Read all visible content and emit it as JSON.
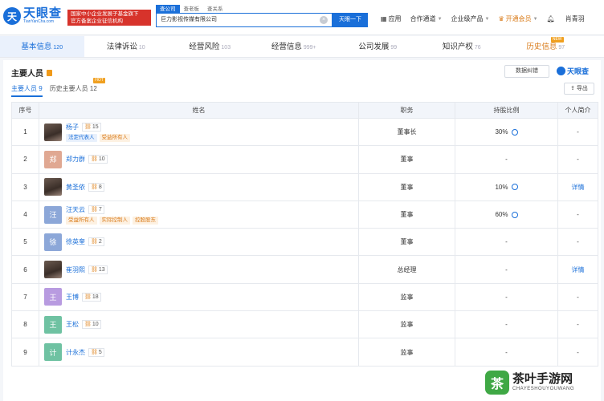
{
  "logo": {
    "cn": "天眼查",
    "en": "TianYanCha.com"
  },
  "gov_badge": {
    "line1": "国家中小企业发展子基金旗下",
    "line2": "官方备案企业征信机构"
  },
  "search": {
    "tabs": [
      "查公司",
      "查老板",
      "查关系"
    ],
    "value": "巨力影视传媒有限公司",
    "button": "天眼一下"
  },
  "topnav": [
    "应用",
    "合作通道",
    "企业级产品",
    "开通会员",
    "肖青羽"
  ],
  "main_tabs": [
    {
      "label": "基本信息",
      "count": "120"
    },
    {
      "label": "法律诉讼",
      "count": "10"
    },
    {
      "label": "经营风险",
      "count": "103"
    },
    {
      "label": "经营信息",
      "count": "999+"
    },
    {
      "label": "公司发展",
      "count": "99"
    },
    {
      "label": "知识产权",
      "count": "76"
    },
    {
      "label": "历史信息",
      "count": "97",
      "badge": "NEW"
    }
  ],
  "section": {
    "title": "主要人员",
    "correct_btn": "数据纠错",
    "brand": "天眼查",
    "export_btn": "导出",
    "sub_tabs": [
      {
        "label": "主要人员",
        "count": "9"
      },
      {
        "label": "历史主要人员",
        "count": "12",
        "badge": "HOT"
      }
    ]
  },
  "table": {
    "headers": [
      "序号",
      "姓名",
      "职务",
      "持股比例",
      "个人简介"
    ],
    "rows": [
      {
        "no": "1",
        "name": "杨子",
        "avatar": "photo",
        "count": "15",
        "tags": [
          {
            "t": "法定代表人",
            "c": "blue"
          },
          {
            "t": "受益所有人",
            "c": "orange"
          }
        ],
        "role": "董事长",
        "share": "30%",
        "clock": true,
        "bio": "-"
      },
      {
        "no": "2",
        "name": "郑力群",
        "avatar": "郑",
        "color": "#e0a892",
        "count": "10",
        "tags": [],
        "role": "董事",
        "share": "-",
        "clock": false,
        "bio": "-"
      },
      {
        "no": "3",
        "name": "黄圣依",
        "avatar": "photo",
        "count": "8",
        "tags": [],
        "role": "董事",
        "share": "10%",
        "clock": true,
        "bio": "详情"
      },
      {
        "no": "4",
        "name": "汪天云",
        "avatar": "汪",
        "color": "#8ca7d8",
        "count": "7",
        "tags": [
          {
            "t": "受益所有人",
            "c": "orange"
          },
          {
            "t": "实际控制人",
            "c": "orange"
          },
          {
            "t": "控股股东",
            "c": "orange"
          }
        ],
        "role": "董事",
        "share": "60%",
        "clock": true,
        "bio": "-"
      },
      {
        "no": "5",
        "name": "徐英奎",
        "avatar": "徐",
        "color": "#8ca7d8",
        "count": "2",
        "tags": [],
        "role": "董事",
        "share": "-",
        "clock": false,
        "bio": "-"
      },
      {
        "no": "6",
        "name": "崔羽熙",
        "avatar": "photo",
        "count": "13",
        "tags": [],
        "role": "总经理",
        "share": "-",
        "clock": false,
        "bio": "详情"
      },
      {
        "no": "7",
        "name": "王博",
        "avatar": "王",
        "color": "#b89be0",
        "count": "18",
        "tags": [],
        "role": "监事",
        "share": "-",
        "clock": false,
        "bio": "-"
      },
      {
        "no": "8",
        "name": "王松",
        "avatar": "王",
        "color": "#6fc2a2",
        "count": "10",
        "tags": [],
        "role": "监事",
        "share": "-",
        "clock": false,
        "bio": "-"
      },
      {
        "no": "9",
        "name": "计永杰",
        "avatar": "计",
        "color": "#6fc2a2",
        "count": "5",
        "tags": [],
        "role": "监事",
        "share": "-",
        "clock": false,
        "bio": "-"
      }
    ]
  },
  "watermark": {
    "icon": "茶",
    "cn": "茶叶手游网",
    "en": "CHAYESHOUYOUWANG"
  }
}
